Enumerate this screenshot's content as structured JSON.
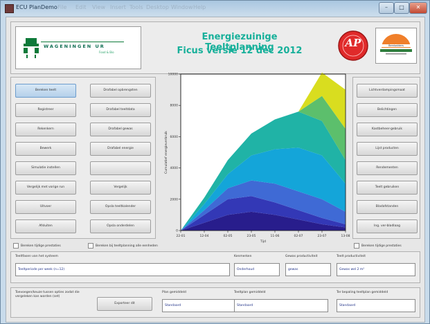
{
  "window": {
    "title": "ECU PlanDemo",
    "menus": [
      "File",
      "Edit",
      "View",
      "Insert",
      "Tools",
      "Desktop",
      "Window",
      "Help"
    ],
    "controls": [
      "–",
      "□",
      "✕"
    ]
  },
  "header": {
    "title_line1": "Energiezuinige Teeltplanning",
    "title_line2": "Ficus versie 12 dec 2012",
    "logo_wur": {
      "name": "WAGENINGEN UR",
      "sub": "Food & Bio"
    },
    "logo_ap": "AP",
    "logo_third": "Bernbakkers"
  },
  "left_buttons": [
    [
      "Bereken teelt",
      "Drafabel opbrengsten"
    ],
    [
      "Registreer",
      "Drafabel teeltdata"
    ],
    [
      "Rekenkern",
      "Drafabel gewas"
    ],
    [
      "Bewerk",
      "Drafabel energie"
    ],
    [
      "Simulatie instellen",
      ""
    ],
    [
      "Vergelijk met vorige run",
      "Vergelijk"
    ],
    [
      "Uitvoer",
      "Opsla teeltkalender"
    ],
    [
      "Afsluiten",
      "Opsla onderdelen"
    ]
  ],
  "right_buttons": [
    "Lichtverdampingsmaat",
    "Belichtingen",
    "Kastbeheer-gebruik",
    "Lijst producten",
    "Rendementen",
    "Teelt gebruiken",
    "Bladafstanden",
    "Ing. ver-bladlaag"
  ],
  "checkboxes": {
    "left1": "Bereken tijdige prestaties",
    "left2": "Bereken bij teeltplanning alle eenheden",
    "right": "Bereken tijdige prestaties"
  },
  "row1": {
    "label_a": "Teeltfasen van het systeem",
    "value_a": "Teeltperiode per week (n=12)",
    "label_b": "Kenmerken",
    "value_b": "Onderhoud",
    "label_c": "Gewas productiviteit",
    "value_c": "gewas",
    "label_d": "Teelt productiviteit",
    "value_d": "Gewas wel 2 m²"
  },
  "row2": {
    "note": "Toevoegen/keuze tussen opties zodat die vergeleken kan worden (set)",
    "button": "Exporteer dit",
    "label_a": "Plan gemiddeld",
    "value_a": "Standaard",
    "label_b": "Teeltplan gemiddeld",
    "value_b": "Standaard",
    "label_c": "Ter bepaling teeltplan gemiddeld",
    "value_c": "Standaard"
  },
  "chart_data": {
    "type": "area",
    "xlabel": "Tijd",
    "ylabel": "Cumulatief energieverbruik",
    "ylim": [
      0,
      10000
    ],
    "x": [
      1,
      2,
      3,
      4,
      5,
      6,
      7,
      8
    ],
    "x_ticks": [
      "22-01",
      "12-04",
      "02-05",
      "23-05",
      "11-06",
      "02-07",
      "23-07",
      "13-08"
    ],
    "y_ticks": [
      0,
      2000,
      4000,
      6000,
      8000,
      10000
    ],
    "series": [
      {
        "color": "#281d8c",
        "values": [
          0,
          500,
          1000,
          1200,
          1000,
          700,
          400,
          200
        ]
      },
      {
        "color": "#3338b6",
        "values": [
          0,
          500,
          1000,
          1000,
          800,
          600,
          400,
          200
        ]
      },
      {
        "color": "#3f6ad5",
        "values": [
          0,
          300,
          700,
          1000,
          1200,
          1200,
          1200,
          800
        ]
      },
      {
        "color": "#14a5d9",
        "values": [
          0,
          400,
          900,
          1600,
          2200,
          2800,
          2800,
          1800
        ]
      },
      {
        "color": "#20b3a6",
        "values": [
          0,
          400,
          900,
          1400,
          1900,
          2300,
          2200,
          1500
        ]
      },
      {
        "color": "#5cbf6c",
        "values": [
          0,
          0,
          0,
          0,
          0,
          0,
          1600,
          2000
        ]
      },
      {
        "color": "#d9dd1f",
        "values": [
          0,
          0,
          0,
          0,
          0,
          0,
          1500,
          2500
        ]
      }
    ]
  }
}
